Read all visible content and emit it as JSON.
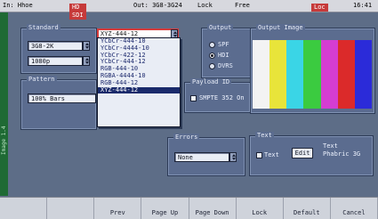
{
  "status": {
    "left": "In: Hhoe",
    "badge": "HD SDI",
    "out": "Out: 3G8-3G24",
    "lock": "Lock",
    "mode": "Free",
    "right": "Loc",
    "time": "16:41"
  },
  "sidebar": {
    "label": "Image 1.4"
  },
  "standard": {
    "title": "Standard",
    "field1": "3G8-2K",
    "field2": "1080p"
  },
  "format": {
    "selected": "XYZ-444-12",
    "options": [
      "YCbCr-444-10",
      "YCbCr-4444-10",
      "YCbCr-422-12",
      "YCbCr-444-12",
      "RGB-444-10",
      "RGBA-4444-10",
      "RGB-444-12",
      "XYZ-444-12"
    ]
  },
  "output": {
    "title": "Output",
    "options": [
      "SPF",
      "HDI",
      "DVRS"
    ],
    "selected": 1
  },
  "pattern": {
    "title": "Pattern",
    "value": "100% Bars"
  },
  "payload": {
    "title": "Payload ID",
    "label": "SMPTE 352 On"
  },
  "errors": {
    "title": "Errors",
    "value": "None"
  },
  "output_image": {
    "title": "Output Image",
    "colors": [
      "#f3f3f3",
      "#e8e43a",
      "#3ad5e6",
      "#3bcb40",
      "#d53dd2",
      "#db2a2a",
      "#2b2bd9"
    ]
  },
  "edit": {
    "title": "Text",
    "check_label": "Text",
    "button": "Edit",
    "text_label": "Text",
    "text_value": "Phabric 3G"
  },
  "softkeys": [
    "",
    "",
    "Prev",
    "Page Up",
    "Page Down",
    "Lock",
    "Default",
    "Cancel"
  ]
}
